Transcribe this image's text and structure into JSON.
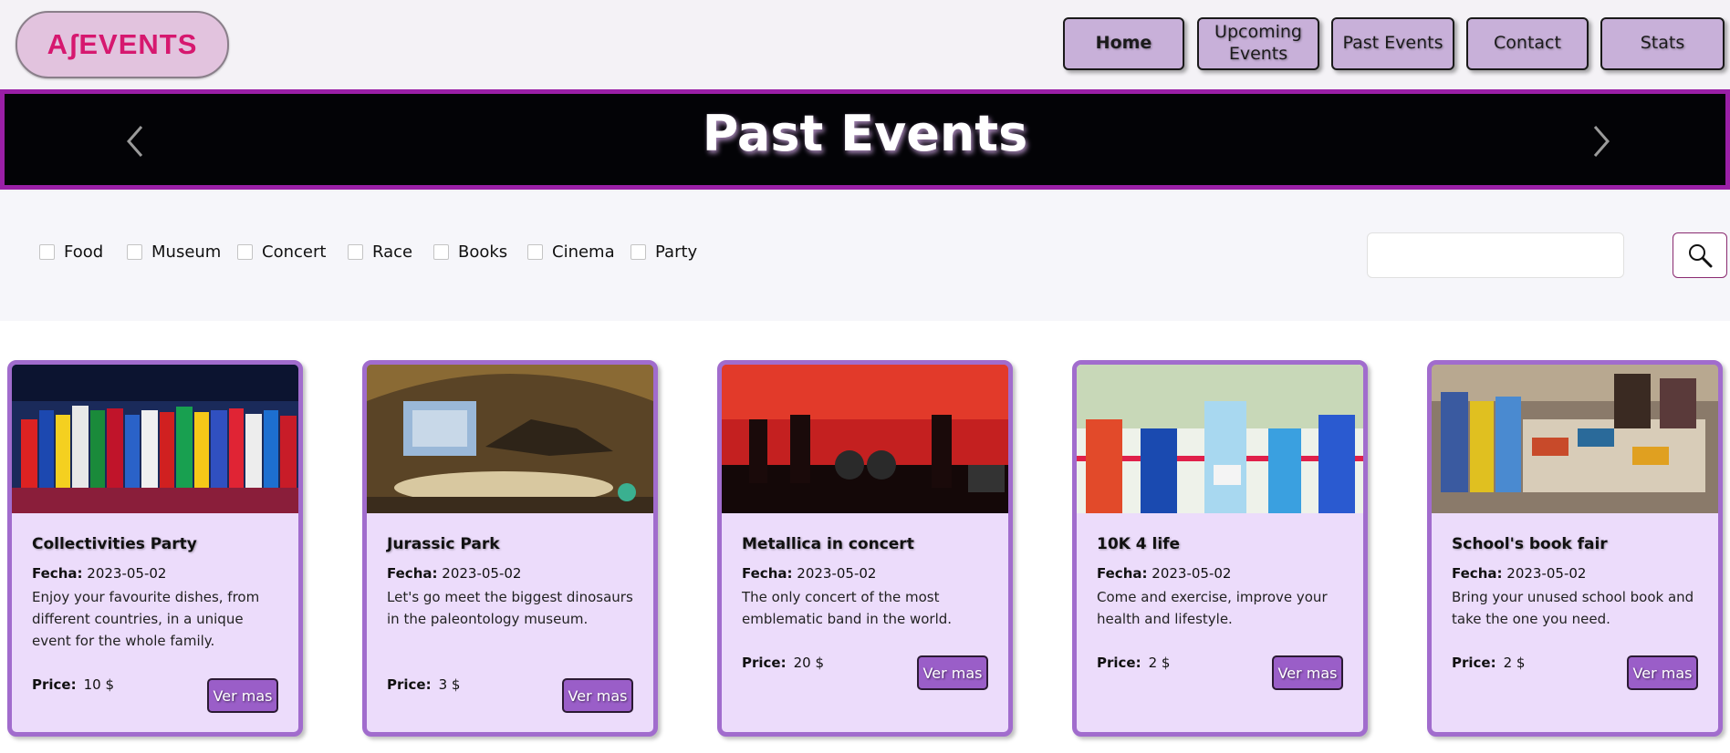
{
  "brand": {
    "logo_text": "AʃEVENTS",
    "accent": "#d6186f"
  },
  "nav": {
    "items": [
      {
        "label": "Home",
        "active": true
      },
      {
        "label": "Upcoming Events",
        "active": false
      },
      {
        "label": "Past Events",
        "active": false
      },
      {
        "label": "Contact",
        "active": false
      },
      {
        "label": "Stats",
        "active": false
      }
    ]
  },
  "banner": {
    "title": "Past Events"
  },
  "filters": {
    "categories": [
      "Food",
      "Museum",
      "Concert",
      "Race",
      "Books",
      "Cinema",
      "Party"
    ],
    "search": {
      "value": "",
      "placeholder": ""
    }
  },
  "cards": [
    {
      "title": "Collectivities Party",
      "date_label": "Fecha:",
      "date": "2023-05-02",
      "description": "Enjoy your favourite dishes, from different countries, in a unique event for the whole family.",
      "price_label": "Price:",
      "price": "10 $",
      "button": "Ver mas"
    },
    {
      "title": "Jurassic Park",
      "date_label": "Fecha:",
      "date": "2023-05-02",
      "description": "Let's go meet the biggest dinosaurs in the paleontology museum.",
      "price_label": "Price:",
      "price": "3 $",
      "button": "Ver mas"
    },
    {
      "title": "Metallica in concert",
      "date_label": "Fecha:",
      "date": "2023-05-02",
      "description": "The only concert of the most emblematic band in the world.",
      "price_label": "Price:",
      "price": "20 $",
      "button": "Ver mas"
    },
    {
      "title": "10K 4 life",
      "date_label": "Fecha:",
      "date": "2023-05-02",
      "description": "Come and exercise, improve your health and lifestyle.",
      "price_label": "Price:",
      "price": "2 $",
      "button": "Ver mas"
    },
    {
      "title": "School's book fair",
      "date_label": "Fecha:",
      "date": "2023-05-02",
      "description": "Bring your unused school book and take the one you need.",
      "price_label": "Price:",
      "price": "2 $",
      "button": "Ver mas"
    }
  ],
  "colors": {
    "banner_border": "#9a1fa6",
    "card_bg": "#ecdcfb",
    "card_border": "#a16ccd",
    "button_bg": "#9a5ec8",
    "nav_bg": "#c8b0d9"
  }
}
